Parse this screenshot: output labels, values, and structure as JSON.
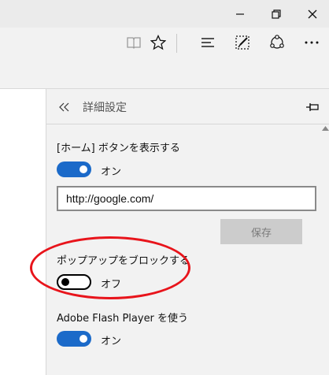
{
  "titlebar": {
    "minimize": "minimize",
    "restore": "restore",
    "close": "close"
  },
  "toolbar": {
    "icons": [
      "reading-view-icon",
      "favorite-star-icon",
      "hub-icon",
      "web-note-icon",
      "share-icon",
      "more-icon"
    ]
  },
  "settings_pane": {
    "title": "詳細設定",
    "home_button": {
      "label": "[ホーム] ボタンを表示する",
      "state_text": "オン",
      "enabled": true
    },
    "home_url": {
      "value": "http://google.com/",
      "placeholder": ""
    },
    "save_label": "保存",
    "popup_block": {
      "label": "ポップアップをブロックする",
      "state_text": "オフ",
      "enabled": false
    },
    "flash_player": {
      "label": "Adobe Flash Player を使う",
      "state_text": "オン",
      "enabled": true
    }
  },
  "colors": {
    "toggle_on": "#1b6ac9",
    "annotation": "#e8141b",
    "pane_bg": "#f2f2f2"
  }
}
